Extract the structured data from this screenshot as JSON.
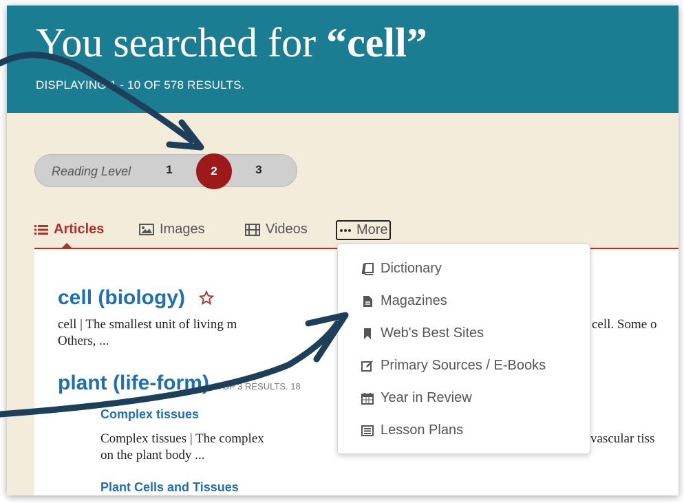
{
  "header": {
    "title_prefix": "You searched for ",
    "query_quoted": "“cell”",
    "results_count": "DISPLAYING 1 - 10 OF 578 RESULTS."
  },
  "reading_level": {
    "label": "Reading Level",
    "levels": [
      "1",
      "2",
      "3"
    ],
    "selected": "2"
  },
  "tabs": [
    {
      "label": "Articles",
      "icon": "list-icon"
    },
    {
      "label": "Images",
      "icon": "image-icon"
    },
    {
      "label": "Videos",
      "icon": "film-icon"
    },
    {
      "label": "More",
      "icon": "ellipsis-icon"
    }
  ],
  "more_menu": [
    {
      "label": "Dictionary",
      "icon": "book-icon"
    },
    {
      "label": "Magazines",
      "icon": "document-icon"
    },
    {
      "label": "Web's Best Sites",
      "icon": "bookmark-icon"
    },
    {
      "label": "Primary Sources / E-Books",
      "icon": "edit-icon"
    },
    {
      "label": "Year in Review",
      "icon": "calendar-icon"
    },
    {
      "label": "Lesson Plans",
      "icon": "list-alt-icon"
    }
  ],
  "results": {
    "r1_title": "cell (biology)",
    "r1_text_a": "cell  |  The smallest unit of living m",
    "r1_text_b": "cell. Some o",
    "r1_text_c": "Others, ...",
    "r2_title": "plant (life-form)",
    "r2_tag": " - TOP 3 RESULTS. 18",
    "sub1_title": "Complex tissues",
    "sub1_text_a": "Complex tissues  | The complex",
    "sub1_text_b": "vascular tiss",
    "sub1_text_c": "on the plant body ...",
    "sub2_title": "Plant Cells and Tissues"
  },
  "colors": {
    "header_bg": "#1b7d91",
    "page_bg": "#f3ecdb",
    "accent_red": "#b0302e",
    "reading_level_active": "#9e1a1a",
    "link_blue": "#1f6fb5",
    "annotation_arrow": "#1d3f59"
  }
}
